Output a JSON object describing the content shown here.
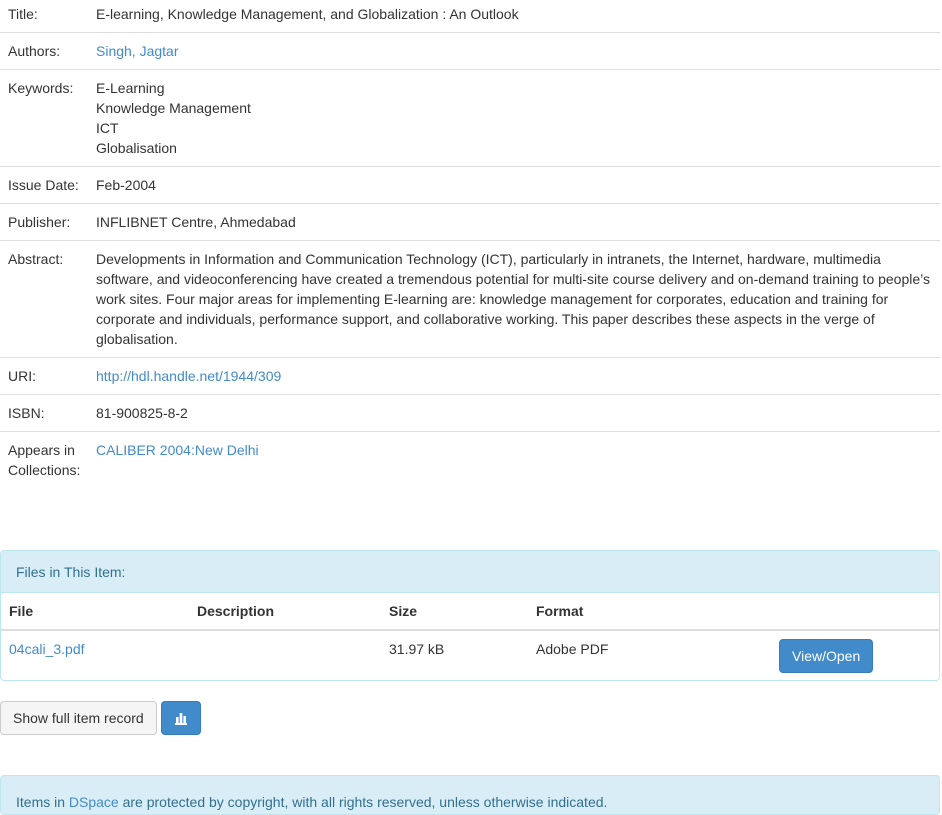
{
  "item": {
    "rows": [
      {
        "label": "Title:",
        "values": [
          "E-learning, Knowledge Management, and Globalization : An Outlook"
        ],
        "link": false
      },
      {
        "label": "Authors:",
        "values": [
          "Singh, Jagtar"
        ],
        "link": true
      },
      {
        "label": "Keywords:",
        "values": [
          "E-Learning",
          "Knowledge Management",
          "ICT",
          "Globalisation"
        ],
        "link": false
      },
      {
        "label": "Issue Date:",
        "values": [
          "Feb-2004"
        ],
        "link": false
      },
      {
        "label": "Publisher:",
        "values": [
          "INFLIBNET Centre, Ahmedabad"
        ],
        "link": false
      },
      {
        "label": "Abstract:",
        "values": [
          "Developments in Information and Communication Technology (ICT), particularly in intranets, the Internet, hardware, multimedia software, and videoconferencing have created a tremendous potential for multi-site course delivery and on-demand training to people’s work sites. Four major areas for implementing E-learning are: knowledge management for corporates, education and training for corporate and individuals, performance support, and collaborative working. This paper describes these aspects in the verge of globalisation."
        ],
        "link": false
      },
      {
        "label": "URI:",
        "values": [
          "http://hdl.handle.net/1944/309"
        ],
        "link": true
      },
      {
        "label": "ISBN:",
        "values": [
          "81-900825-8-2"
        ],
        "link": false
      },
      {
        "label": "Appears in Collections:",
        "values": [
          "CALIBER 2004:New Delhi"
        ],
        "link": true
      }
    ]
  },
  "files": {
    "heading": "Files in This Item:",
    "columns": [
      "File",
      "Description",
      "Size",
      "Format"
    ],
    "rows": [
      {
        "file": "04cali_3.pdf",
        "description": "",
        "size": "31.97 kB",
        "format": "Adobe PDF",
        "action": "View/Open"
      }
    ]
  },
  "buttons": {
    "full_record": "Show full item record",
    "stats_icon": "bar-chart-icon"
  },
  "notice": {
    "prefix": "Items in ",
    "link": "DSpace",
    "suffix": " are protected by copyright, with all rights reserved, unless otherwise indicated."
  },
  "colors": {
    "link": "#428bca",
    "info_bg": "#d9edf7",
    "info_text": "#31708f",
    "primary_button": "#428bca"
  }
}
